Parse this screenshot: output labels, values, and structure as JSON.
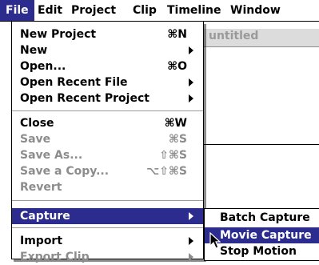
{
  "menubar": {
    "items": [
      {
        "label": "File"
      },
      {
        "label": "Edit"
      },
      {
        "label": "Project"
      },
      {
        "label": "Clip"
      },
      {
        "label": "Timeline"
      },
      {
        "label": "Window"
      }
    ]
  },
  "background_window": {
    "title": "untitled"
  },
  "file_menu": {
    "items": [
      {
        "label": "New Project",
        "shortcut": "⌘N",
        "enabled": true
      },
      {
        "label": "New",
        "enabled": true,
        "submenu": true
      },
      {
        "label": "Open...",
        "shortcut": "⌘O",
        "enabled": true
      },
      {
        "label": "Open Recent File",
        "enabled": true,
        "submenu": true
      },
      {
        "label": "Open Recent Project",
        "enabled": true,
        "submenu": true
      },
      {
        "label": "Close",
        "shortcut": "⌘W",
        "enabled": true
      },
      {
        "label": "Save",
        "shortcut": "⌘S",
        "enabled": false
      },
      {
        "label": "Save As...",
        "shortcut": "⇧⌘S",
        "enabled": false
      },
      {
        "label": "Save a Copy...",
        "shortcut": "⌥⇧⌘S",
        "enabled": false
      },
      {
        "label": "Revert",
        "enabled": false
      },
      {
        "label": "Capture",
        "enabled": true,
        "submenu": true,
        "selected": true
      },
      {
        "label": "Import",
        "enabled": true,
        "submenu": true
      },
      {
        "label": "Export Clip",
        "enabled": false,
        "submenu": true
      }
    ]
  },
  "capture_submenu": {
    "items": [
      {
        "label": "Batch Capture"
      },
      {
        "label": "Movie Capture",
        "selected": true
      },
      {
        "label": "Stop Motion"
      }
    ]
  },
  "colors": {
    "highlight": "#2c2c8e",
    "disabled_text": "#8c8c8c"
  }
}
